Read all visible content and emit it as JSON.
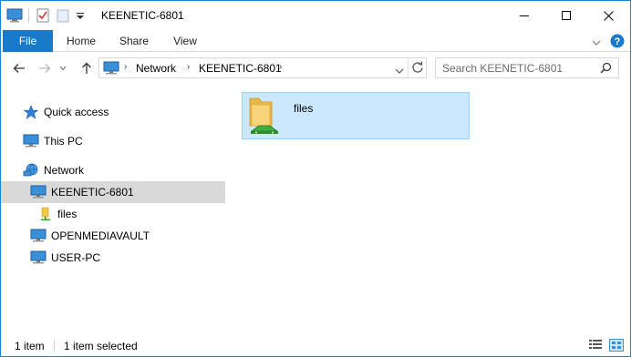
{
  "window": {
    "title": "KEENETIC-6801",
    "minimize_glyph": "—",
    "maximize_glyph": "☐",
    "close_glyph": "✕"
  },
  "ribbon": {
    "tabs": [
      "File",
      "Home",
      "Share",
      "View"
    ]
  },
  "address": {
    "crumbs": [
      "Network",
      "KEENETIC-6801"
    ],
    "search_placeholder": "Search KEENETIC-6801"
  },
  "nav_pane": {
    "items": [
      {
        "label": "Quick access",
        "icon": "star-icon"
      },
      {
        "label": "This PC",
        "icon": "computer-icon"
      },
      {
        "label": "Network",
        "icon": "network-icon"
      },
      {
        "label": "KEENETIC-6801",
        "icon": "computer-icon",
        "selected": true
      },
      {
        "label": "files",
        "icon": "network-share-icon"
      },
      {
        "label": "OPENMEDIAVAULT",
        "icon": "computer-icon"
      },
      {
        "label": "USER-PC",
        "icon": "computer-icon"
      }
    ]
  },
  "content": {
    "items": [
      {
        "label": "files",
        "icon": "network-share-icon",
        "selected": true
      }
    ]
  },
  "status": {
    "item_count": "1 item",
    "selected_count": "1 item selected"
  },
  "colors": {
    "accent": "#1979ca",
    "selection_bg": "#cce8ff",
    "selection_border": "#99d1ff",
    "nav_selected_bg": "#d9d9d9"
  }
}
